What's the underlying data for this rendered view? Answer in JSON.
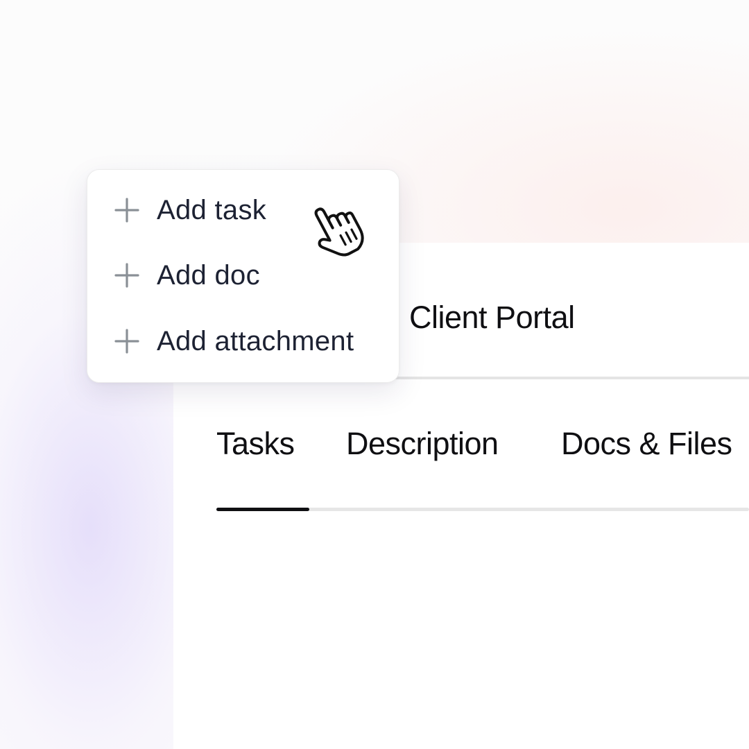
{
  "menu": {
    "items": [
      {
        "label": "Add task",
        "icon": "plus-icon"
      },
      {
        "label": "Add doc",
        "icon": "plus-icon"
      },
      {
        "label": "Add attachment",
        "icon": "plus-icon"
      }
    ]
  },
  "header": {
    "title": "Client Portal"
  },
  "tabs": [
    {
      "label": "Tasks",
      "active": true
    },
    {
      "label": "Description",
      "active": false
    },
    {
      "label": "Docs & Files",
      "active": false
    }
  ],
  "cursor": {
    "icon": "hand-pointer-icon"
  },
  "colors": {
    "text": "#0f0f12",
    "menu_text": "#1d2233",
    "icon": "#8a9096",
    "divider": "#e4e4e4",
    "accent_glow": "#e2dafa"
  }
}
